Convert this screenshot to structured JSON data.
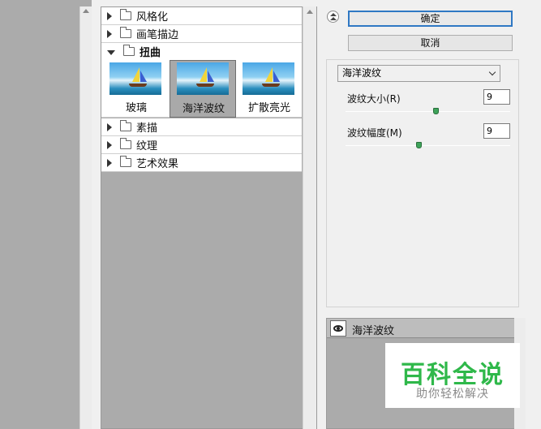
{
  "categories": [
    {
      "label": "风格化",
      "open": false
    },
    {
      "label": "画笔描边",
      "open": false
    },
    {
      "label": "扭曲",
      "open": true
    },
    {
      "label": "素描",
      "open": false
    },
    {
      "label": "纹理",
      "open": false
    },
    {
      "label": "艺术效果",
      "open": false
    }
  ],
  "thumbnails": [
    {
      "label": "玻璃",
      "selected": false
    },
    {
      "label": "海洋波纹",
      "selected": true
    },
    {
      "label": "扩散亮光",
      "selected": false
    }
  ],
  "buttons": {
    "ok": "确定",
    "cancel": "取消"
  },
  "filter_select": {
    "value": "海洋波纹"
  },
  "params": {
    "size": {
      "label": "波纹大小(R)",
      "value": "9",
      "level_percent": 55
    },
    "magnitude": {
      "label": "波纹幅度(M)",
      "value": "9",
      "level_percent": 45
    }
  },
  "layer": {
    "name": "海洋波纹"
  },
  "watermark": {
    "title": "百科全说",
    "subtitle": "助你轻松解决"
  },
  "colors": {
    "selection_border": "#2f78c4",
    "slider_knob": "#3ea35a",
    "watermark_green": "#2fb84a"
  }
}
